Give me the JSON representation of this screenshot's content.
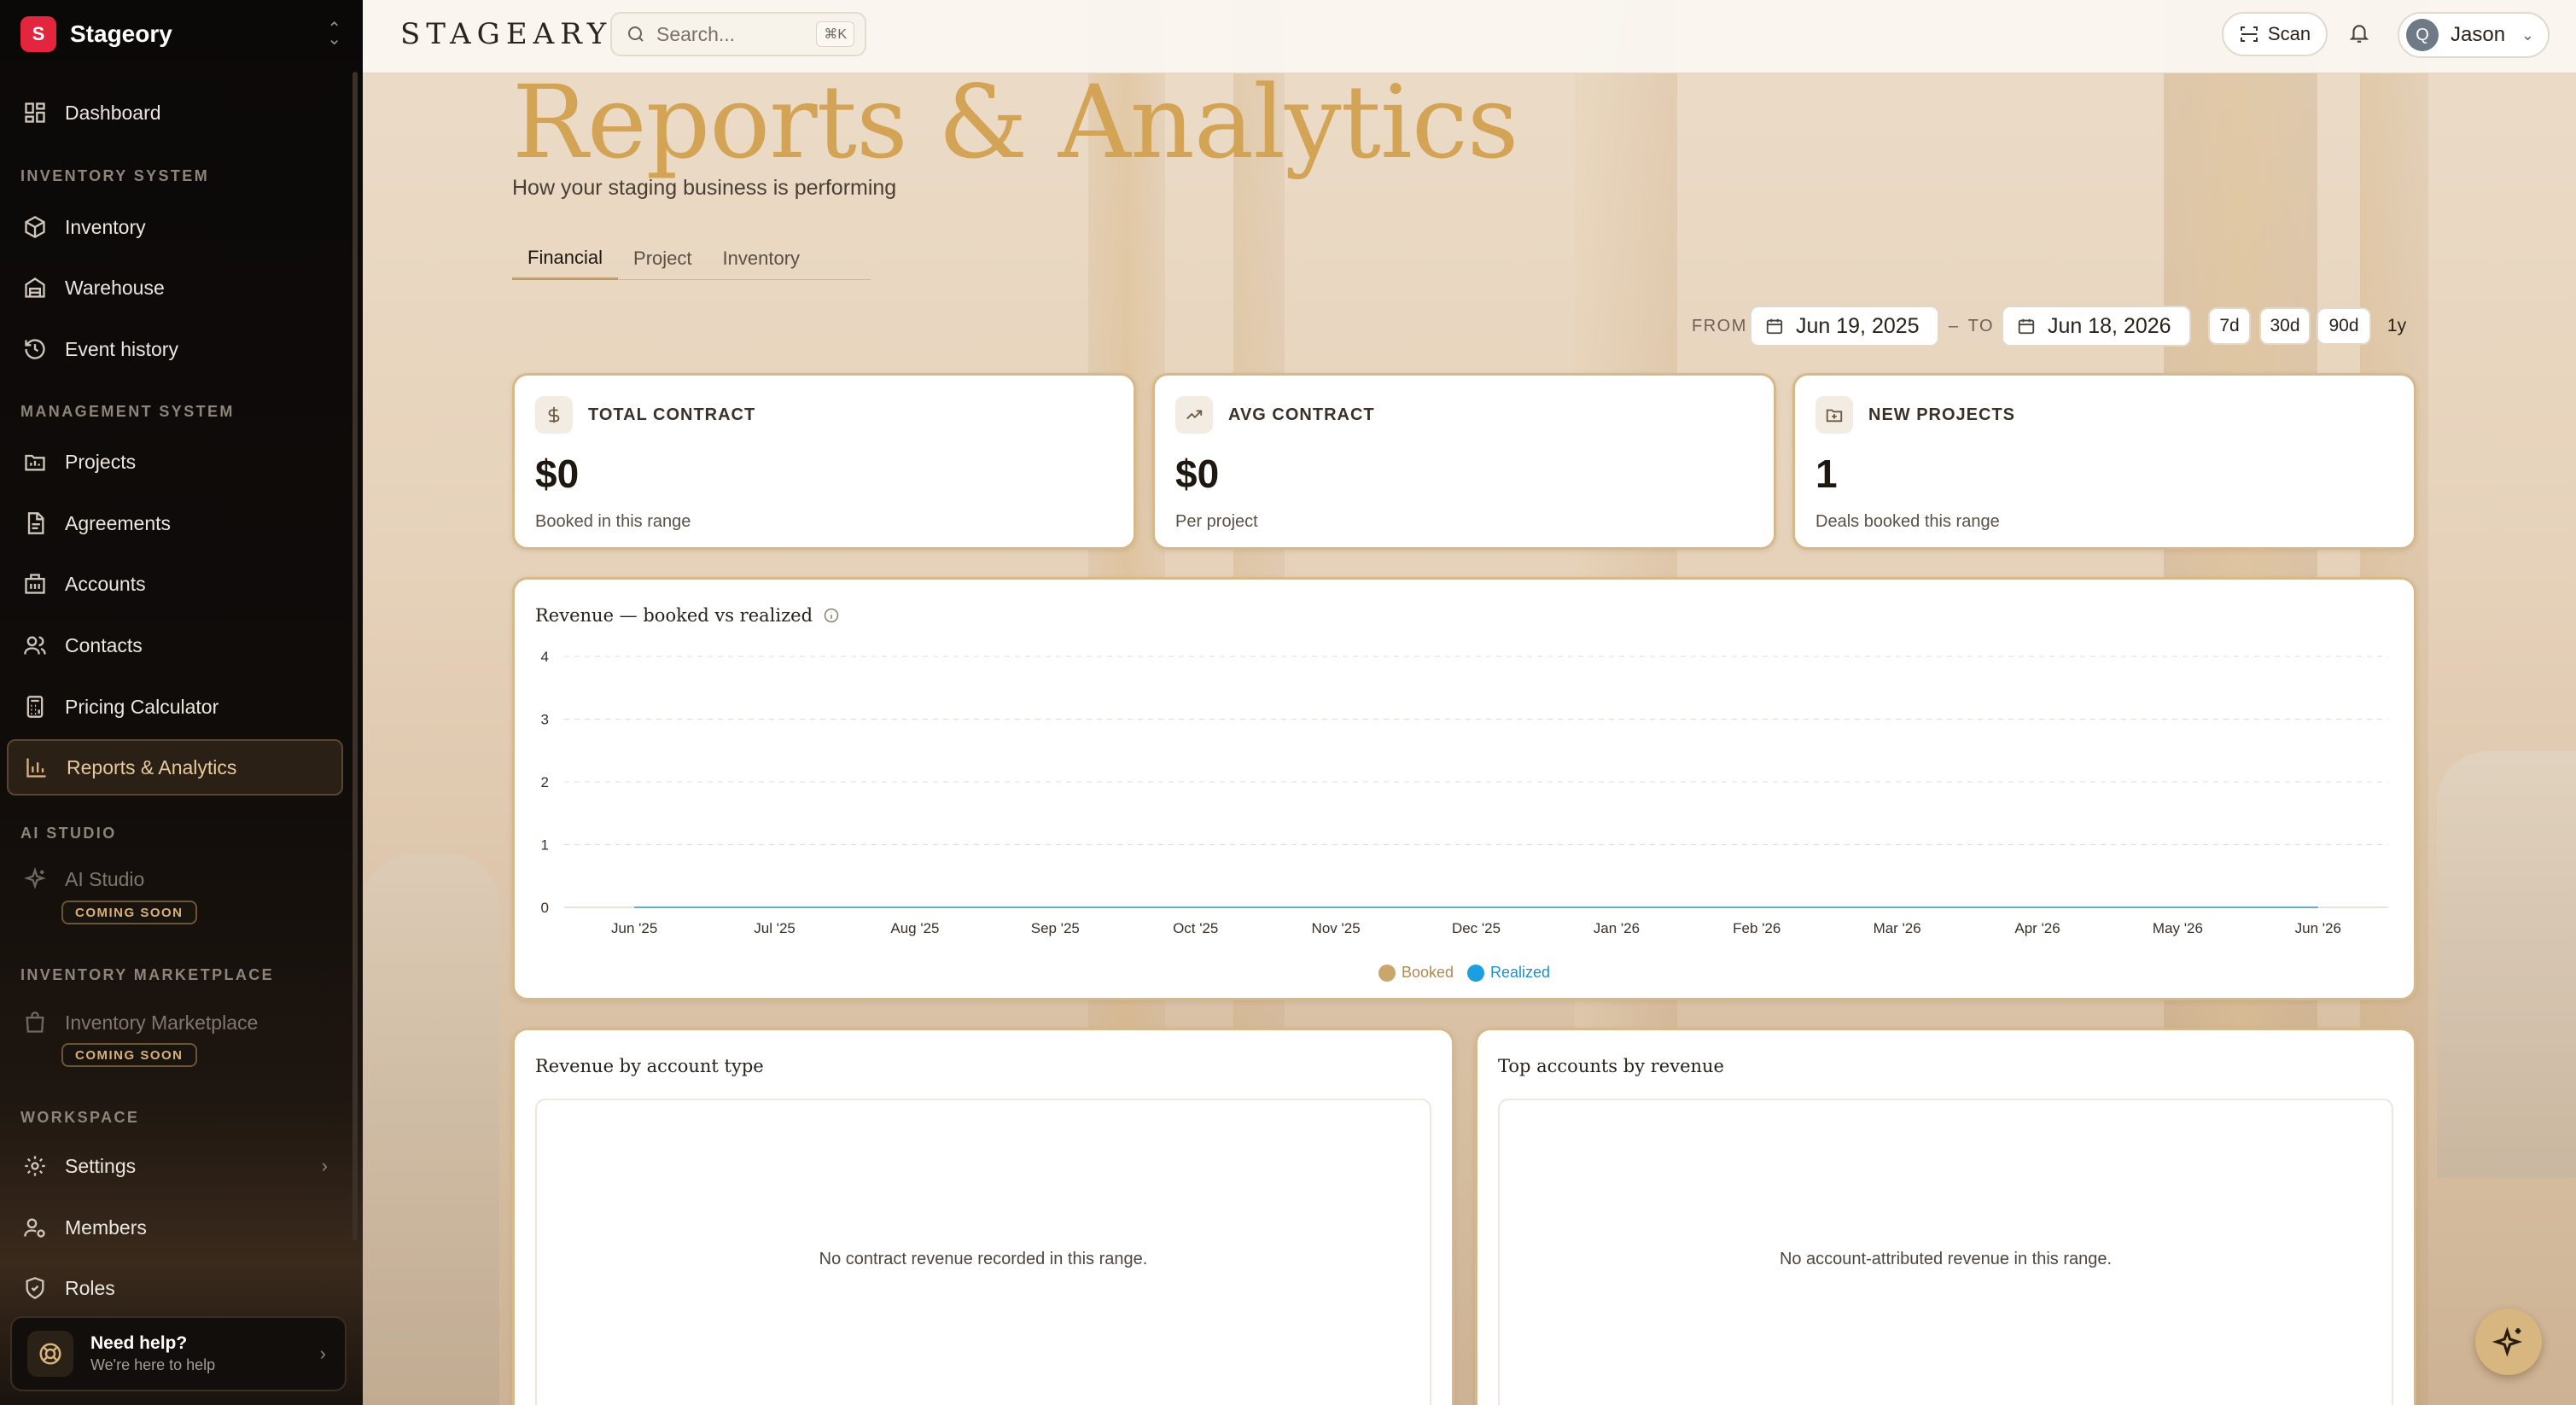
{
  "brand": {
    "name": "Stageory",
    "logo_letter": "S",
    "wordmark": "STAGEARY",
    "accent": "#e3263d"
  },
  "search": {
    "placeholder": "Search...",
    "shortcut": "⌘K"
  },
  "topbar": {
    "scan_label": "Scan",
    "user_initial": "Q",
    "user_name": "Jason"
  },
  "sidebar": {
    "dashboard": "Dashboard",
    "sections": {
      "inventory_system": "INVENTORY SYSTEM",
      "management_system": "MANAGEMENT SYSTEM",
      "ai_studio": "AI STUDIO",
      "inventory_marketplace": "INVENTORY MARKETPLACE",
      "workspace": "WORKSPACE"
    },
    "items": {
      "inventory": "Inventory",
      "warehouse": "Warehouse",
      "event_history": "Event history",
      "projects": "Projects",
      "agreements": "Agreements",
      "accounts": "Accounts",
      "contacts": "Contacts",
      "pricing_calculator": "Pricing Calculator",
      "reports": "Reports & Analytics",
      "ai_studio": "AI Studio",
      "inventory_marketplace": "Inventory Marketplace",
      "settings": "Settings",
      "members": "Members",
      "roles": "Roles"
    },
    "coming_soon": "COMING SOON",
    "help": {
      "title": "Need help?",
      "subtitle": "We're here to help"
    }
  },
  "page": {
    "title": "Reports & Analytics",
    "subtitle": "How your staging business is performing",
    "tabs": [
      "Financial",
      "Project",
      "Inventory"
    ]
  },
  "range": {
    "from_label": "FROM",
    "to_label": "TO",
    "separator": "–",
    "from": "Jun 19, 2025",
    "to": "Jun 18, 2026",
    "presets": [
      "7d",
      "30d",
      "90d",
      "1y"
    ]
  },
  "kpis": [
    {
      "label": "TOTAL CONTRACT",
      "value": "$0",
      "note": "Booked in this range",
      "icon": "dollar-icon"
    },
    {
      "label": "AVG CONTRACT",
      "value": "$0",
      "note": "Per project",
      "icon": "trending-up-icon"
    },
    {
      "label": "NEW PROJECTS",
      "value": "1",
      "note": "Deals booked this range",
      "icon": "folder-plus-icon"
    }
  ],
  "chart_data": {
    "type": "line",
    "title": "Revenue — booked vs realized",
    "categories": [
      "Jun '25",
      "Jul '25",
      "Aug '25",
      "Sep '25",
      "Oct '25",
      "Nov '25",
      "Dec '25",
      "Jan '26",
      "Feb '26",
      "Mar '26",
      "Apr '26",
      "May '26",
      "Jun '26"
    ],
    "series": [
      {
        "name": "Booked",
        "color": "#c9a66b",
        "values": [
          0,
          0,
          0,
          0,
          0,
          0,
          0,
          0,
          0,
          0,
          0,
          0,
          0
        ]
      },
      {
        "name": "Realized",
        "color": "#1b9fe0",
        "values": [
          0,
          0,
          0,
          0,
          0,
          0,
          0,
          0,
          0,
          0,
          0,
          0,
          0
        ]
      }
    ],
    "yticks": [
      0,
      1,
      2,
      3,
      4
    ],
    "ylim": [
      0,
      4
    ],
    "grid": true,
    "legend": "bottom-center"
  },
  "panels": {
    "by_account_type": {
      "title": "Revenue by account type",
      "empty": "No contract revenue recorded in this range."
    },
    "top_accounts": {
      "title": "Top accounts by revenue",
      "empty": "No account-attributed revenue in this range."
    }
  }
}
